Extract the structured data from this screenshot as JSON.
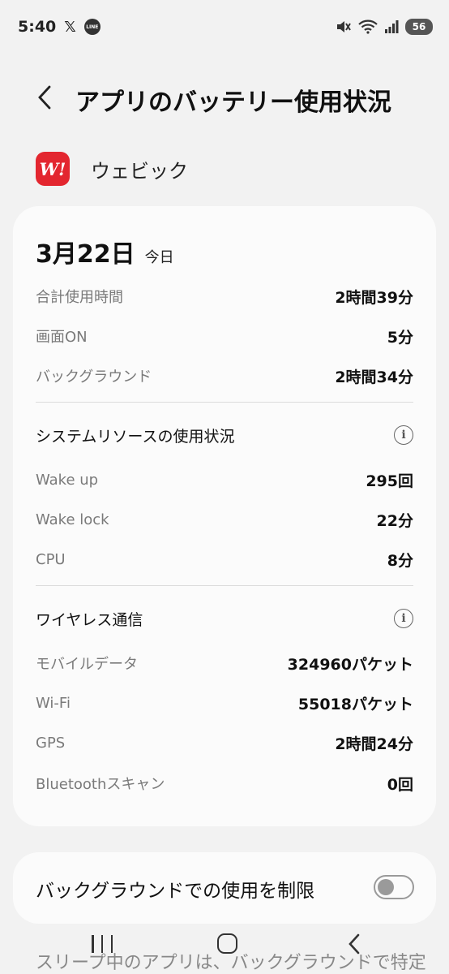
{
  "status_bar": {
    "time": "5:40",
    "x_icon": "x-logo-icon",
    "line_icon_text": "LINE",
    "battery": "56"
  },
  "header": {
    "title": "アプリのバッテリー使用状況"
  },
  "app": {
    "icon_text": "W!",
    "name": "ウェビック",
    "icon_color": "#e3262f"
  },
  "usage": {
    "date": "3月22日",
    "today": "今日",
    "rows": [
      {
        "label": "合計使用時間",
        "value": "2時間39分"
      },
      {
        "label": "画面ON",
        "value": "5分"
      },
      {
        "label": "バックグラウンド",
        "value": "2時間34分"
      }
    ]
  },
  "system_resources": {
    "title": "システムリソースの使用状況",
    "rows": [
      {
        "label": "Wake up",
        "value": "295回"
      },
      {
        "label": "Wake lock",
        "value": "22分"
      },
      {
        "label": "CPU",
        "value": "8分"
      }
    ]
  },
  "wireless": {
    "title": "ワイヤレス通信",
    "rows": [
      {
        "label": "モバイルデータ",
        "value": "324960パケット"
      },
      {
        "label": "Wi-Fi",
        "value": "55018パケット"
      },
      {
        "label": "GPS",
        "value": "2時間24分"
      },
      {
        "label": "Bluetoothスキャン",
        "value": "0回"
      }
    ]
  },
  "restrict": {
    "label": "バックグラウンドでの使用を制限",
    "enabled": false
  },
  "partial_text": "スリープ中のアプリは、バックグラウンドで特定"
}
